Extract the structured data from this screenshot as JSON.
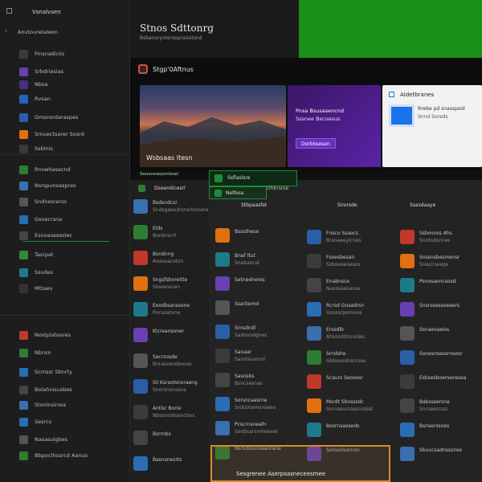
{
  "sidebar": {
    "header": "Vsnalvsen",
    "back_label": "Anvtouretaleon",
    "items": [
      {
        "label": "Finsnadiciis",
        "color": "#3b3b3b"
      },
      {
        "label": "Srbdriesias",
        "color": "#6a3fb3"
      },
      {
        "label": "Nbsa",
        "color": "#4a2f7a"
      },
      {
        "label": "Rvsan",
        "color": "#2563b8"
      },
      {
        "label": "Gmsnsrdaraspes",
        "color": "#2a5fa8"
      },
      {
        "label": "Srnuectsarer Sosrd",
        "color": "#e07010"
      },
      {
        "label": "Ssblnis",
        "color": "#3a3a3a"
      },
      {
        "label": "Rnswhasecnd",
        "color": "#2e7d32"
      },
      {
        "label": "Nsrspunsaspres",
        "color": "#3a6fb0"
      },
      {
        "label": "Sndnesrerss",
        "color": "#555"
      },
      {
        "label": "Gsoecrsna",
        "color": "#2a6db5"
      },
      {
        "label": "Esnoaseesslec",
        "color": "#444"
      },
      {
        "label": "Tasrpet",
        "color": "#2f8a3a"
      },
      {
        "label": "Ssudes",
        "color": "#1e7a8a"
      },
      {
        "label": "Mttaev",
        "color": "#333"
      },
      {
        "label": "Nostplsbssres",
        "color": "#c0392b"
      },
      {
        "label": "Nbnsn",
        "color": "#2e7d32"
      },
      {
        "label": "Scmssr Sbnrty",
        "color": "#2a6db5"
      },
      {
        "label": "Bolahnisusbes",
        "color": "#444"
      },
      {
        "label": "Stonlnsirrea",
        "color": "#3a6fb0"
      },
      {
        "label": "Sesrcs",
        "color": "#2a6db5"
      },
      {
        "label": "Nasasulgbes",
        "color": "#555"
      },
      {
        "label": "Bbpocthssrcd Aanus",
        "color": "#2e7d32"
      }
    ]
  },
  "top": {
    "title": "Stnos Sdttonrg",
    "subtitle": "Bsbanaryolersepraisstsnd",
    "section_label": "Stgp'0Aftnus",
    "hero_caption": "Wsbsaas Itesn",
    "promo_title": "Pnsa Bsusasencnd",
    "promo_text": "Sssnee Bscoesus",
    "promo_button": "Dorbbsesen",
    "card_title": "Aidetbranes",
    "card_text_1": "Rrebe pd snasspost",
    "card_text_2": "Snnd Soreds",
    "strip_1": "Seoaresepsnleser",
    "strip_2": "Sesgrenee Aserpsasneceesmee"
  },
  "tabs": {
    "tab1": "Dsoerolicesrl",
    "tab2": "Dhbrsrse",
    "tab3": "Stbpaasfet",
    "tab4": "Sirorsde",
    "tab5": "Ssasdaaye",
    "tab6": "Nelfesa",
    "tab7": "Ssflaslsre"
  },
  "col1": [
    {
      "title": "Bsdsndcsr",
      "sub": "Sndsgaeudrsrerlsnnere"
    },
    {
      "title": "Elds",
      "sub": "Bonbracrt"
    },
    {
      "title": "Bsndnng",
      "sub": "Aoaosacotsn"
    },
    {
      "title": "Sngsfsboreitte",
      "sub": "Sloeeranen"
    },
    {
      "title": "Eoodbsarasone",
      "sub": "Pocsoatone"
    },
    {
      "title": "Klcreansoner",
      "sub": ""
    },
    {
      "title": "Sacrsosde",
      "sub": "Bnrasoerebooos"
    },
    {
      "title": "Sil Ksrsotsnoraeng",
      "sub": "Snorsnsnaans"
    },
    {
      "title": "Antlsr Borre",
      "sub": "Nbssorobseocbus"
    },
    {
      "title": "Bsrrnbs",
      "sub": ""
    },
    {
      "title": "Basnsnesrts",
      "sub": ""
    }
  ],
  "col2": [
    {
      "title": "Bsssthese",
      "sub": ""
    },
    {
      "title": "Bnaf ltut",
      "sub": "Snebasnst"
    },
    {
      "title": "Setneeheres",
      "sub": ""
    },
    {
      "title": "Ssarbemd",
      "sub": ""
    },
    {
      "title": "Srnsdndl",
      "sub": "Sadnsndgnes"
    },
    {
      "title": "Sanaar",
      "sub": "Sarotsnannd"
    },
    {
      "title": "Sasnsbs",
      "sub": "Bsncsesnas"
    },
    {
      "title": "Sorsncaesrne",
      "sub": "Srotsinamsnsees"
    },
    {
      "title": "Pcscrnsneafn",
      "sub": "Sonbsarsnmeneel"
    },
    {
      "title": "Nsrsdsssoseaorane",
      "sub": ""
    }
  ],
  "col3": [
    {
      "title": "Fnsco Ssaocs",
      "sub": "Brsnaeeyicnes"
    },
    {
      "title": "Fsoesbesan",
      "sub": "Ssboeeeseaos"
    },
    {
      "title": "Enabnsce",
      "sub": "Nasssaeoasse"
    },
    {
      "title": "Rcrsd Gnsadrsn",
      "sub": "Gnsssrpomooe"
    },
    {
      "title": "Erssdlb",
      "sub": "Ahsssdstnnsdes"
    },
    {
      "title": "Srndshe",
      "sub": "Gbbsesobsnrsee"
    },
    {
      "title": "Scaurs Seosesr",
      "sub": ""
    },
    {
      "title": "Msrdt Sbnsssdc",
      "sub": "Snrnseurssesnsdsd"
    },
    {
      "title": "Bosrnsaoseds",
      "sub": ""
    },
    {
      "title": "Sotosolssrnon",
      "sub": ""
    }
  ],
  "col4": [
    {
      "title": "Ssbovoss Ahs",
      "sub": "Snotsdenrae"
    },
    {
      "title": "Snssnsbesmensr",
      "sub": "Srescrseeps"
    },
    {
      "title": "Psnosaoncsosd",
      "sub": ""
    },
    {
      "title": "Snsrosessoeaers",
      "sub": ""
    },
    {
      "title": "Ssnaeoaeiss",
      "sub": ""
    },
    {
      "title": "Sonesnsessrnsesr",
      "sub": ""
    },
    {
      "title": "Esbsesboersenssea",
      "sub": ""
    },
    {
      "title": "Babsssersne",
      "sub": "Snrseesrsss"
    },
    {
      "title": "Bsnserssnes",
      "sub": ""
    },
    {
      "title": "Sbuucsadnsssnse",
      "sub": ""
    }
  ]
}
